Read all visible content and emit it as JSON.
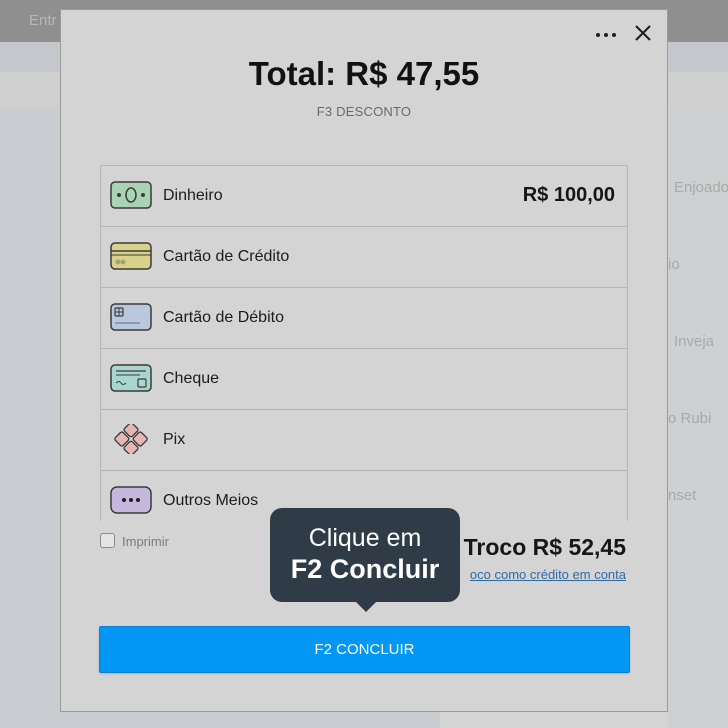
{
  "background": {
    "topbar_text": "Entr",
    "side_items": [
      "Enjoado",
      "io",
      "Inveja",
      "o Rubi",
      "nset"
    ]
  },
  "modal": {
    "title": "Total: R$ 47,55",
    "discount_label": "F3 DESCONTO",
    "menu_icon": "more-horizontal-icon",
    "close_icon": "close-icon"
  },
  "payment_methods": [
    {
      "label": "Dinheiro",
      "amount": "R$ 100,00",
      "icon": "cash-icon"
    },
    {
      "label": "Cartão de Crédito",
      "amount": "",
      "icon": "credit-card-icon"
    },
    {
      "label": "Cartão de Débito",
      "amount": "",
      "icon": "debit-card-icon"
    },
    {
      "label": "Cheque",
      "amount": "",
      "icon": "check-icon"
    },
    {
      "label": "Pix",
      "amount": "",
      "icon": "pix-icon"
    },
    {
      "label": "Outros Meios",
      "amount": "",
      "icon": "other-methods-icon"
    }
  ],
  "print": {
    "label": "Imprimir",
    "checked": false
  },
  "change": {
    "label": "Troco R$ 52,45",
    "link": "oco como crédito em conta"
  },
  "tooltip": {
    "line1": "Clique em",
    "line2": "F2 Concluir"
  },
  "confirm_button": "F2 CONCLUIR",
  "colors": {
    "primary": "#0296f5",
    "tooltip_bg": "#2f3b47",
    "link": "#2f6aa3"
  }
}
